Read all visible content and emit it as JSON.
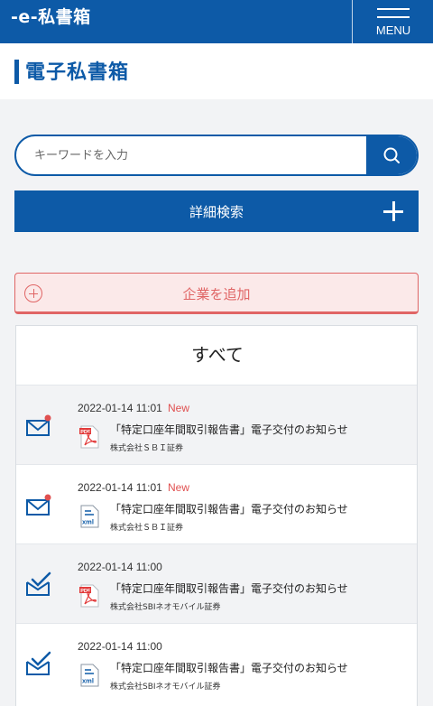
{
  "header": {
    "logo": "-e-私書箱",
    "menu_label": "MENU"
  },
  "page_title": "電子私書箱",
  "search": {
    "placeholder": "キーワードを入力",
    "value": ""
  },
  "advanced_search": {
    "label": "詳細検索"
  },
  "add_company": {
    "label": "企業を追加"
  },
  "panel": {
    "title": "すべて"
  },
  "messages": [
    {
      "date": "2022-01-14 11:01",
      "badge": "New",
      "unread": true,
      "file_type": "pdf",
      "subject": "「特定口座年間取引報告書」電子交付のお知らせ",
      "company": "株式会社ＳＢＩ証券"
    },
    {
      "date": "2022-01-14 11:01",
      "badge": "New",
      "unread": true,
      "file_type": "xml",
      "subject": "「特定口座年間取引報告書」電子交付のお知らせ",
      "company": "株式会社ＳＢＩ証券"
    },
    {
      "date": "2022-01-14 11:00",
      "badge": "",
      "unread": false,
      "file_type": "pdf",
      "subject": "「特定口座年間取引報告書」電子交付のお知らせ",
      "company": "株式会社SBIネオモバイル証券"
    },
    {
      "date": "2022-01-14 11:00",
      "badge": "",
      "unread": false,
      "file_type": "xml",
      "subject": "「特定口座年間取引報告書」電子交付のお知らせ",
      "company": "株式会社SBIネオモバイル証券"
    }
  ],
  "colors": {
    "brand_blue": "#0d5aa7",
    "accent_red": "#e06565",
    "unread_dot": "#e05050"
  },
  "icons": {
    "search": "search-icon",
    "plus": "plus-icon",
    "add": "add-circle-icon",
    "unread": "envelope-unread-icon",
    "read": "envelope-read-icon",
    "pdf": "pdf-file-icon",
    "xml": "xml-file-icon"
  }
}
